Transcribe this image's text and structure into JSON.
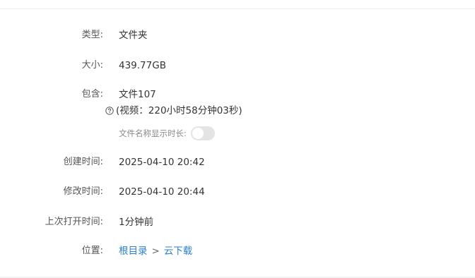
{
  "details": {
    "type_label": "类型:",
    "type_value": "文件夹",
    "size_label": "大小:",
    "size_value": "439.77GB",
    "contains_label": "包含:",
    "contains_value": "文件107",
    "video_summary": "(视频：220小时58分钟03秒)",
    "show_duration_label": "文件名称显示时长:",
    "show_duration_enabled": false,
    "created_label": "创建时间:",
    "created_value": "2025-04-10 20:42",
    "modified_label": "修改时间:",
    "modified_value": "2025-04-10 20:44",
    "last_opened_label": "上次打开时间:",
    "last_opened_value": "1分钟前",
    "location_label": "位置:",
    "location_path": [
      "根目录",
      "云下载"
    ],
    "location_separator": ">"
  },
  "colors": {
    "link": "#2b7fd1",
    "label": "#555555",
    "value": "#333333",
    "toggle_off": "#e4e4e4"
  },
  "icons": {
    "help": "question-circle-icon"
  }
}
